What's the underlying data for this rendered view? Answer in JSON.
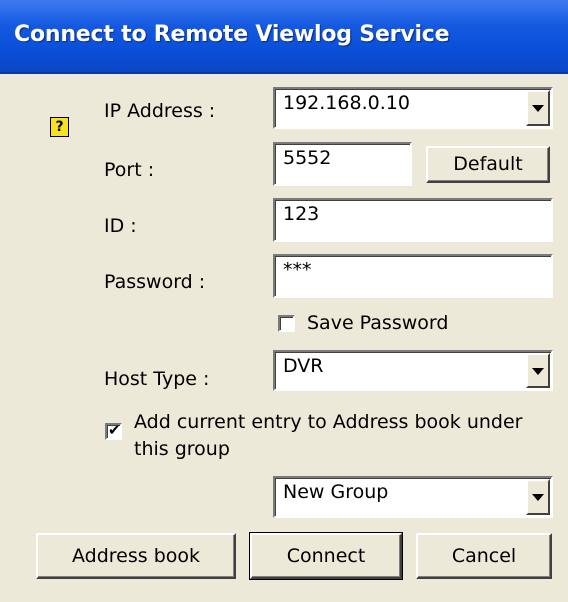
{
  "window": {
    "title": "Connect to Remote Viewlog Service"
  },
  "icons": {
    "help": "question-mark-icon"
  },
  "form": {
    "ip_label": "IP Address :",
    "ip_value": "192.168.0.10",
    "port_label": "Port :",
    "port_value": "5552",
    "default_button": "Default",
    "id_label": "ID :",
    "id_value": "123",
    "password_label": "Password :",
    "password_value": "***",
    "save_password_label": "Save Password",
    "save_password_checked": false,
    "host_type_label": "Host Type :",
    "host_type_value": "DVR",
    "add_entry_label_line1": "Add current entry to Address book under",
    "add_entry_label_line2": "this group",
    "add_entry_checked": true,
    "group_value": "New Group"
  },
  "buttons": {
    "address_book": "Address book",
    "connect": "Connect",
    "cancel": "Cancel"
  },
  "colors": {
    "titlebar": "#0a4fd8",
    "background": "#ece9d8",
    "help_icon": "#f6e21e"
  }
}
